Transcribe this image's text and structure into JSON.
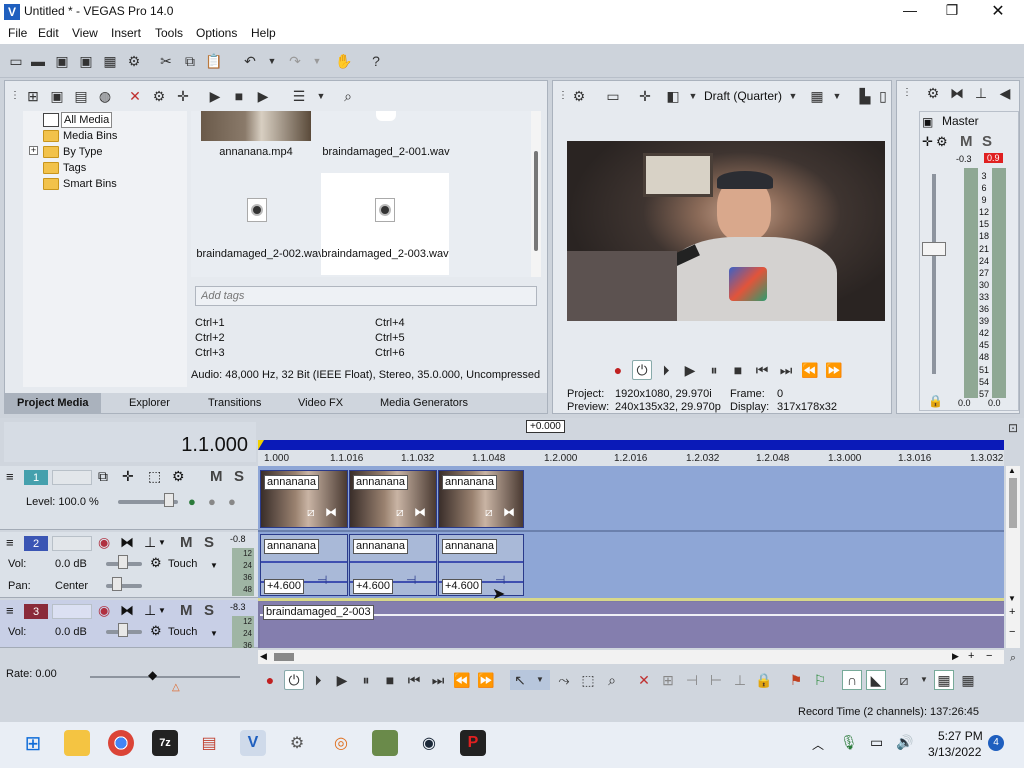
{
  "window": {
    "title": "Untitled * - VEGAS Pro 14.0",
    "min_label": "—",
    "max_label": "❐",
    "close_label": "✕"
  },
  "menu": [
    "File",
    "Edit",
    "View",
    "Insert",
    "Tools",
    "Options",
    "Help"
  ],
  "explorer": {
    "tree": [
      "All Media",
      "Media Bins",
      "By Type",
      "Tags",
      "Smart Bins"
    ],
    "expand_label": "+",
    "files": [
      {
        "name": "annanana.mp4"
      },
      {
        "name": "braindamaged_2-001.wav"
      },
      {
        "name": "braindamaged_2-002.wav"
      },
      {
        "name": "braindamaged_2-003.wav"
      }
    ],
    "tags_placeholder": "Add tags",
    "shortcuts": [
      "Ctrl+1",
      "Ctrl+2",
      "Ctrl+3",
      "Ctrl+4",
      "Ctrl+5",
      "Ctrl+6"
    ],
    "audio_info": "Audio: 48,000 Hz, 32 Bit (IEEE Float), Stereo, 35.0.000, Uncompressed",
    "tabs": [
      "Project Media",
      "Explorer",
      "Transitions",
      "Video FX",
      "Media Generators"
    ]
  },
  "preview": {
    "quality": "Draft (Quarter)",
    "project_label": "Project:",
    "project_value": "1920x1080, 29.970i",
    "preview_label": "Preview:",
    "preview_value": "240x135x32, 29.970p",
    "frame_label": "Frame:",
    "frame_value": "0",
    "display_label": "Display:",
    "display_value": "317x178x32",
    "frame_image_note": "webcam"
  },
  "master": {
    "title": "Master",
    "m_label": "M",
    "s_label": "S",
    "peak_left": "-0.3",
    "peak_right": "0.9",
    "scale": [
      "3",
      "6",
      "9",
      "12",
      "15",
      "18",
      "21",
      "24",
      "27",
      "30",
      "33",
      "36",
      "39",
      "42",
      "45",
      "48",
      "51",
      "54",
      "57"
    ],
    "bottom_left": "0.0",
    "bottom_right": "0.0"
  },
  "timeline": {
    "timecode": "1.1.000",
    "offset_label": "+0.000",
    "ruler": [
      "1.000",
      "1.1.016",
      "1.1.032",
      "1.1.048",
      "1.2.000",
      "1.2.016",
      "1.2.032",
      "1.2.048",
      "1.3.000",
      "1.3.016",
      "1.3.032"
    ],
    "track1": {
      "num": "1",
      "level": "Level: 100.0 %",
      "m": "M",
      "s": "S"
    },
    "track2": {
      "num": "2",
      "vol_label": "Vol:",
      "vol": "0.0 dB",
      "pan_label": "Pan:",
      "pan": "Center",
      "mode": "Touch",
      "m": "M",
      "s": "S",
      "peak": "-0.8",
      "scale": [
        "12",
        "24",
        "36",
        "48"
      ]
    },
    "track3": {
      "num": "3",
      "vol_label": "Vol:",
      "vol": "0.0 dB",
      "mode": "Touch",
      "m": "M",
      "s": "S",
      "peak": "-8.3",
      "scale": [
        "12",
        "24",
        "36"
      ]
    },
    "video_clips": [
      "annanana",
      "annanana",
      "annanana"
    ],
    "audio_clips": [
      "annanana",
      "annanana",
      "annanana"
    ],
    "clip_gain": "+4.600",
    "audio3_clip": "braindamaged_2-003",
    "rate": "Rate: 0.00",
    "record_time": "Record Time (2 channels): 137:26:45"
  },
  "taskbar": {
    "time": "5:27 PM",
    "date": "3/13/2022",
    "badge": "4"
  },
  "colors": {
    "accent": "#1a2bd4",
    "red": "#e02020",
    "clip_audio": "#a9b9d8",
    "timeline_bg": "#8ea6d6"
  }
}
